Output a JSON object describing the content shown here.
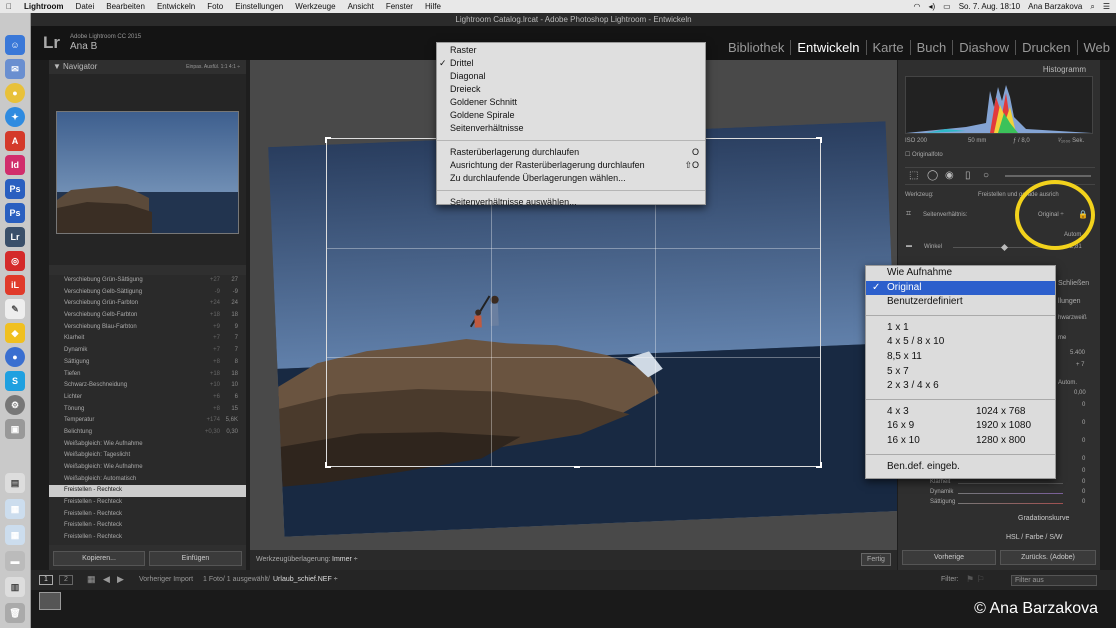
{
  "menubar": {
    "app": "Lightroom",
    "items": [
      "Datei",
      "Bearbeiten",
      "Entwickeln",
      "Foto",
      "Einstellungen",
      "Werkzeuge",
      "Ansicht",
      "Fenster",
      "Hilfe"
    ],
    "clock": "So. 7. Aug.  18:10",
    "user": "Ana Barzakova"
  },
  "window": {
    "title": "Lightroom Catalog.lrcat - Adobe Photoshop Lightroom - Entwickeln"
  },
  "identity": {
    "product": "Adobe Lightroom CC 2015",
    "user": "Ana B"
  },
  "modules": [
    "Bibliothek",
    "Entwickeln",
    "Karte",
    "Buch",
    "Diashow",
    "Drucken",
    "Web"
  ],
  "navigator": {
    "title": "Navigator",
    "modes": "Einpas.  Ausfül.  1:1  4:1 ÷"
  },
  "history": [
    {
      "label": "Verschiebung Grün-Sättigung",
      "a": "+27",
      "b": "27"
    },
    {
      "label": "Verschiebung Gelb-Sättigung",
      "a": "-9",
      "b": "-9"
    },
    {
      "label": "Verschiebung Grün-Farbton",
      "a": "+24",
      "b": "24"
    },
    {
      "label": "Verschiebung Gelb-Farbton",
      "a": "+18",
      "b": "18"
    },
    {
      "label": "Verschiebung Blau-Farbton",
      "a": "+9",
      "b": "9"
    },
    {
      "label": "Klarheit",
      "a": "+7",
      "b": "7"
    },
    {
      "label": "Dynamik",
      "a": "+7",
      "b": "7"
    },
    {
      "label": "Sättigung",
      "a": "+8",
      "b": "8"
    },
    {
      "label": "Tiefen",
      "a": "+18",
      "b": "18"
    },
    {
      "label": "Schwarz-Beschneidung",
      "a": "+10",
      "b": "10"
    },
    {
      "label": "Lichter",
      "a": "+6",
      "b": "6"
    },
    {
      "label": "Tönung",
      "a": "+8",
      "b": "15"
    },
    {
      "label": "Temperatur",
      "a": "+174",
      "b": "5,6K"
    },
    {
      "label": "Belichtung",
      "a": "+0,30",
      "b": "0,30"
    },
    {
      "label": "Weißabgleich: Wie Aufnahme",
      "a": "",
      "b": ""
    },
    {
      "label": "Weißabgleich: Tageslicht",
      "a": "",
      "b": ""
    },
    {
      "label": "Weißabgleich: Wie Aufnahme",
      "a": "",
      "b": ""
    },
    {
      "label": "Weißabgleich: Automatisch",
      "a": "",
      "b": ""
    },
    {
      "label": "Freistellen - Rechteck",
      "a": "",
      "b": ""
    },
    {
      "label": "Freistellen - Rechteck",
      "a": "",
      "b": ""
    },
    {
      "label": "Freistellen - Rechteck",
      "a": "",
      "b": ""
    },
    {
      "label": "Freistellen - Rechteck",
      "a": "",
      "b": ""
    },
    {
      "label": "Freistellen - Rechteck",
      "a": "",
      "b": ""
    }
  ],
  "history_selected": 18,
  "left_buttons": {
    "copy": "Kopieren...",
    "paste": "Einfügen"
  },
  "toolbar": {
    "overlay_label": "Werkzeugüberlagerung:",
    "overlay_value": "Immer ÷",
    "done": "Fertig"
  },
  "overlay_menu": {
    "group1": [
      {
        "label": "Raster",
        "check": ""
      },
      {
        "label": "Drittel",
        "check": "✓"
      },
      {
        "label": "Diagonal",
        "check": ""
      },
      {
        "label": "Dreieck",
        "check": ""
      },
      {
        "label": "Goldener Schnitt",
        "check": ""
      },
      {
        "label": "Goldene Spirale",
        "check": ""
      },
      {
        "label": "Seitenverhältnisse",
        "check": ""
      }
    ],
    "group2": [
      {
        "label": "Rasterüberlagerung durchlaufen",
        "key": "O"
      },
      {
        "label": "Ausrichtung der Rasterüberlagerung durchlaufen",
        "key": "⇧O"
      },
      {
        "label": "Zu durchlaufende Überlagerungen wählen...",
        "key": ""
      }
    ],
    "group3": [
      {
        "label": "Seitenverhältnisse auswählen...",
        "key": ""
      }
    ]
  },
  "crop_menu": {
    "top": [
      {
        "label": "Wie Aufnahme",
        "check": ""
      },
      {
        "label": "Original",
        "check": "✓"
      },
      {
        "label": "Benutzerdefiniert",
        "check": ""
      }
    ],
    "mid": [
      "1 x 1",
      "4 x 5 / 8 x 10",
      "8,5 x 11",
      "5 x 7",
      "2 x 3 / 4 x 6"
    ],
    "ratios": [
      {
        "l": "4 x 3",
        "r": "1024 x 768"
      },
      {
        "l": "16 x 9",
        "r": "1920 x 1080"
      },
      {
        "l": "16 x 10",
        "r": "1280 x 800"
      }
    ],
    "custom": "Ben.def. eingeb."
  },
  "right": {
    "histogram_title": "Histogramm",
    "iso": "ISO 200",
    "focal": "50 mm",
    "aperture": "ƒ / 8,0",
    "shutter": "¹⁄₁₀₀₀ Sek.",
    "original_photo": "Originalfoto",
    "tool_label": "Werkzeug:",
    "tool_value": "Freistellen und gerade ausrich",
    "aspect_label": "Seitenverhältnis:",
    "aspect_value": "Original ÷",
    "auto": "Autom.",
    "angle_label": "Winkel",
    "angle_value": "-2,81",
    "close": "Schließen",
    "settings_part": "llungen",
    "bw_part": "hwarzweiß",
    "temp_part": "me",
    "temp_value": "5.400",
    "tint_value": "+ 7",
    "auto2": "Autom.",
    "val1": "0,00",
    "val2": "0",
    "val3": "0",
    "val4": "0",
    "val5": "0",
    "val6": "0",
    "rows": [
      {
        "label": "Klarheit",
        "value": "0"
      },
      {
        "label": "Dynamik",
        "value": "0"
      },
      {
        "label": "Sättigung",
        "value": "0"
      }
    ],
    "tone_curve": "Gradationskurve",
    "hsl": "HSL / Farbe / S/W",
    "prev": "Vorherige",
    "reset": "Zurücks. (Adobe)"
  },
  "filmstrip": {
    "p1": "1",
    "p2": "2",
    "prev_import": "Vorheriger Import",
    "count": "1 Foto/ 1 ausgewählt/",
    "file": "Urlaub_schief.NEF ÷",
    "filter_label": "Filter:",
    "filter_value": "Filter aus"
  },
  "copyright": "© Ana Barzakova",
  "colors": {
    "accent": "#2c5fcc",
    "highlight": "#f2d21c"
  }
}
